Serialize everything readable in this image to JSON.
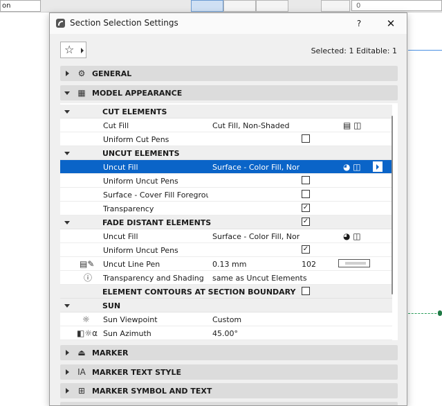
{
  "background": {
    "left_input": "on",
    "right_input": "0"
  },
  "dialog": {
    "title": "Section Selection Settings",
    "help_label": "?",
    "close_label": "✕",
    "selected_info": "Selected: 1 Editable: 1"
  },
  "sections": {
    "general": "GENERAL",
    "model_appearance": "MODEL APPEARANCE",
    "marker": "MARKER",
    "marker_text_style": "MARKER TEXT STYLE",
    "marker_symbol_and_text": "MARKER SYMBOL AND TEXT"
  },
  "rows": {
    "cut_elements": "CUT ELEMENTS",
    "cut_fill": {
      "name": "Cut Fill",
      "value": "Cut Fill, Non-Shaded"
    },
    "uniform_cut_pens": {
      "name": "Uniform Cut Pens",
      "checked": false
    },
    "uncut_elements": "UNCUT ELEMENTS",
    "uncut_fill": {
      "name": "Uncut Fill",
      "value": "Surface - Color Fill, Non..."
    },
    "uniform_uncut_pens": {
      "name": "Uniform Uncut Pens",
      "checked": false
    },
    "surface_cover_fill": {
      "name": "Surface - Cover Fill Foregrou...",
      "checked": false
    },
    "transparency": {
      "name": "Transparency",
      "checked": true
    },
    "fade_distant_elements": {
      "name": "FADE DISTANT ELEMENTS",
      "checked": true
    },
    "fade_uncut_fill": {
      "name": "Uncut Fill",
      "value": "Surface - Color Fill, Non..."
    },
    "fade_uniform_uncut_pens": {
      "name": "Uniform Uncut Pens",
      "checked": true
    },
    "uncut_line_pen": {
      "name": "Uncut Line Pen",
      "value": "0.13 mm",
      "pen": "102"
    },
    "transparency_shading": {
      "name": "Transparency and Shading",
      "value": "same as Uncut Elements"
    },
    "element_contours": {
      "name": "ELEMENT CONTOURS AT SECTION BOUNDARY",
      "checked": false
    },
    "sun": "SUN",
    "sun_viewpoint": {
      "name": "Sun Viewpoint",
      "value": "Custom"
    },
    "sun_azimuth": {
      "name": "Sun Azimuth",
      "value": "45.00°"
    }
  },
  "icons": {
    "favorites": "star-icon",
    "general": "general-settings-icon",
    "model_appearance": "model-appearance-icon",
    "cut_fill": "fill-type-icon",
    "uncut_line_pen": "pen-icon",
    "transparency_shading": "info-icon",
    "sun_viewpoint": "sun-icon",
    "sun_azimuth": "azimuth-icon",
    "marker": "marker-icon",
    "marker_text_style": "text-style-icon",
    "marker_symbol_and_text": "marker-symbol-icon"
  },
  "colors": {
    "selection": "#0a64c8",
    "section_header": "#dcdcdc"
  }
}
